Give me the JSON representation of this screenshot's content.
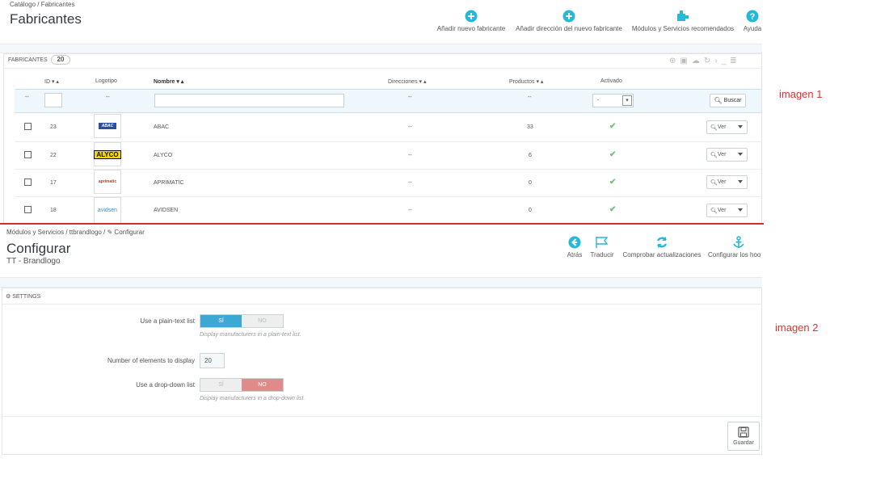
{
  "top": {
    "breadcrumb": "Catálogo  /  Fabricantes",
    "title": "Fabricantes",
    "toolbar": [
      {
        "label": "Añadir nuevo fabricante",
        "icon": "plus-circle-icon"
      },
      {
        "label": "Añadir dirección del nuevo fabricante",
        "icon": "plus-circle-icon"
      },
      {
        "label": "Módulos y Servicios recomendados",
        "icon": "puzzle-icon"
      },
      {
        "label": "Ayuda",
        "icon": "help-icon"
      }
    ],
    "panel": {
      "title": "FABRICANTES",
      "count": "20"
    },
    "columns": {
      "id": "ID ▾ ▴",
      "logo": "Logotipo",
      "name": "Nombre ▾ ▴",
      "addresses": "Direcciones ▾ ▴",
      "products": "Productos ▾ ▴",
      "enabled": "Activado"
    },
    "filter": {
      "dash1": "--",
      "dash2": "--",
      "dash3": "--",
      "dash4": "--",
      "select": "-",
      "search_btn": "Buscar"
    },
    "rows": [
      {
        "id": "23",
        "logo": "ABAC",
        "name": "ABAC",
        "addresses": "--",
        "products": "33",
        "view": "Ver"
      },
      {
        "id": "22",
        "logo": "ALYCO",
        "name": "ALYCO",
        "addresses": "--",
        "products": "6",
        "view": "Ver"
      },
      {
        "id": "17",
        "logo": "aprimatic",
        "name": "APRIMATIC",
        "addresses": "--",
        "products": "0",
        "view": "Ver"
      },
      {
        "id": "18",
        "logo": "avidsen",
        "name": "AVIDSEN",
        "addresses": "--",
        "products": "0",
        "view": "Ver"
      }
    ]
  },
  "bottom": {
    "breadcrumb": "Módulos y Servicios  /  ttbrandlogo  /  ✎ Configurar",
    "title": "Configurar",
    "subtitle": "TT - Brandlogo",
    "toolbar": [
      {
        "label": "Atrás",
        "icon": "back-arrow-icon"
      },
      {
        "label": "Traducir",
        "icon": "flag-icon"
      },
      {
        "label": "Comprobar actualizaciones",
        "icon": "refresh-icon"
      },
      {
        "label": "Configurar los hoo",
        "icon": "anchor-icon"
      }
    ],
    "panel_title": "SETTINGS",
    "fields": {
      "plain_label": "Use a plain-text list",
      "plain_yes": "SÍ",
      "plain_no": "NO",
      "plain_help": "Display manufacturers in a plain-text list.",
      "num_label": "Number of elements to display",
      "num_value": "20",
      "drop_label": "Use a drop-down list",
      "drop_yes": "SÍ",
      "drop_no": "NO",
      "drop_help": "Display manufacturers in a drop-down list."
    },
    "save": "Guardar"
  },
  "annotations": {
    "image1": "imagen 1",
    "image2": "imagen 2"
  },
  "colors": {
    "accent": "#25b9d7",
    "switch_on": "#3ea8d4",
    "switch_no_on": "#e08a8a",
    "divider": "#d9292f",
    "check": "#72c279"
  }
}
